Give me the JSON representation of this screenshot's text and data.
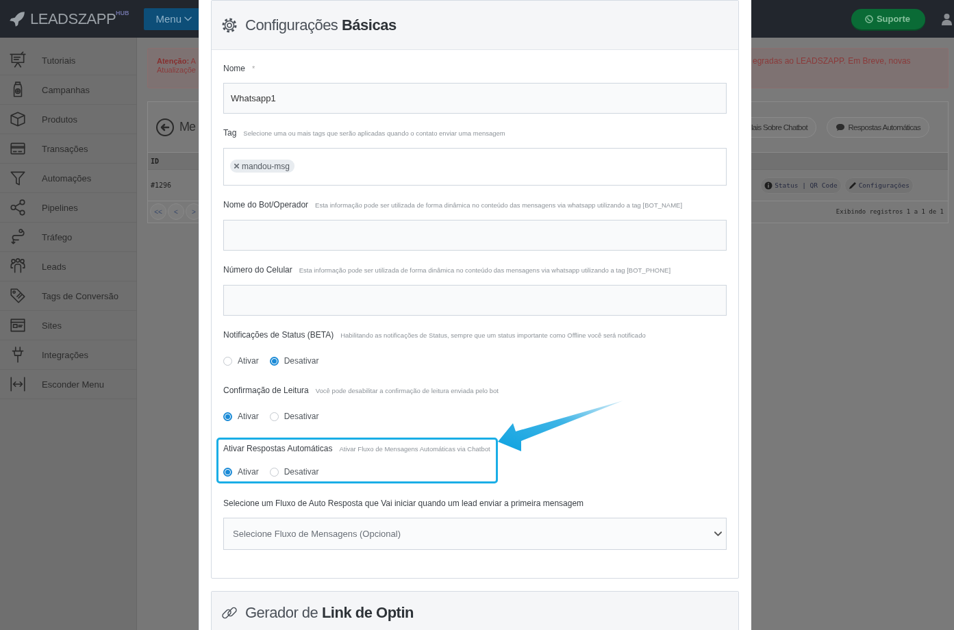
{
  "brand": {
    "name": "LEADSZAPP",
    "suffix": "HUB"
  },
  "menu_button": "Menu",
  "support_button": "Suporte",
  "sidebar": {
    "items": [
      {
        "label": "Tutoriais"
      },
      {
        "label": "Campanhas"
      },
      {
        "label": "Produtos"
      },
      {
        "label": "Transações"
      },
      {
        "label": "Automações"
      },
      {
        "label": "Pipelines"
      },
      {
        "label": "Tráfego"
      },
      {
        "label": "Leads"
      },
      {
        "label": "Tags de Conversão"
      },
      {
        "label": "Sites"
      },
      {
        "label": "Integrações"
      },
      {
        "label": "Esconder Menu"
      }
    ]
  },
  "alert": {
    "left_line_1": "**Atenção:** A",
    "left_line_2": "Atualizaçõe",
    "right_line_1": "egradas ao LEADSZAPP. Em Breve, novas"
  },
  "background_panel": {
    "title": "Me",
    "buttons": [
      "lais Sobre Chatbot",
      "Respostas Automáticas"
    ],
    "column_1": "ID",
    "row": {
      "id": "#1296",
      "actions": [
        "Status | QR Code",
        "Configurações"
      ]
    },
    "pagination": [
      "<<",
      "<",
      ">"
    ],
    "footer": "Exibindo registros 1 a 1 de 1"
  },
  "modal": {
    "sections": [
      {
        "title": "Configurações **Básicas**",
        "fields": [
          {
            "kind": "text",
            "label": "Nome",
            "required_mark": "*",
            "value": "Whatsapp1"
          },
          {
            "kind": "tags",
            "label": "Tag",
            "hint": "Selecione uma ou mais tags que serão aplicadas quando o contato enviar uma mensagem",
            "tags": [
              "mandou-msg"
            ]
          },
          {
            "kind": "text",
            "label": "Nome do Bot/Operador",
            "hint": "Esta informação pode ser utilizada de forma dinâmica no conteúdo das mensagens via whatsapp utilizando a tag [BOT_NAME]"
          },
          {
            "kind": "text",
            "label": "Número do Celular",
            "hint": "Esta informação pode ser utilizada de forma dinâmica no conteúdo das mensagens via whatsapp utilizando a tag [BOT_PHONE]"
          },
          {
            "kind": "radio",
            "label": "Notificações de Status (BETA)",
            "hint": "Habilitando as notificações de Status, sempre que um status importante como Offline você será notificado",
            "options": [
              {
                "label": "Ativar",
                "selected": false
              },
              {
                "label": "Desativar",
                "selected": true
              }
            ]
          },
          {
            "kind": "radio",
            "label": "Confirmação de Leitura",
            "hint": "Você pode desabilitar a confirmação de leitura enviada pelo bot",
            "options": [
              {
                "label": "Ativar",
                "selected": true
              },
              {
                "label": "Desativar",
                "selected": false
              }
            ]
          },
          {
            "kind": "radio",
            "label": "Ativar Respostas Automáticas",
            "hint": "Ativar Fluxo de Mensagens Automáticas via Chatbot",
            "highlighted": true,
            "options": [
              {
                "label": "Ativar",
                "selected": true
              },
              {
                "label": "Desativar",
                "selected": false
              }
            ]
          },
          {
            "kind": "select",
            "label": "Selecione um Fluxo de Auto Resposta que Vai iniciar quando um lead enviar a primeira mensagem",
            "placeholder": "Selecione Fluxo de Mensagens (Opcional)"
          }
        ]
      },
      {
        "title": "Gerador de **Link de Optin**"
      }
    ]
  }
}
